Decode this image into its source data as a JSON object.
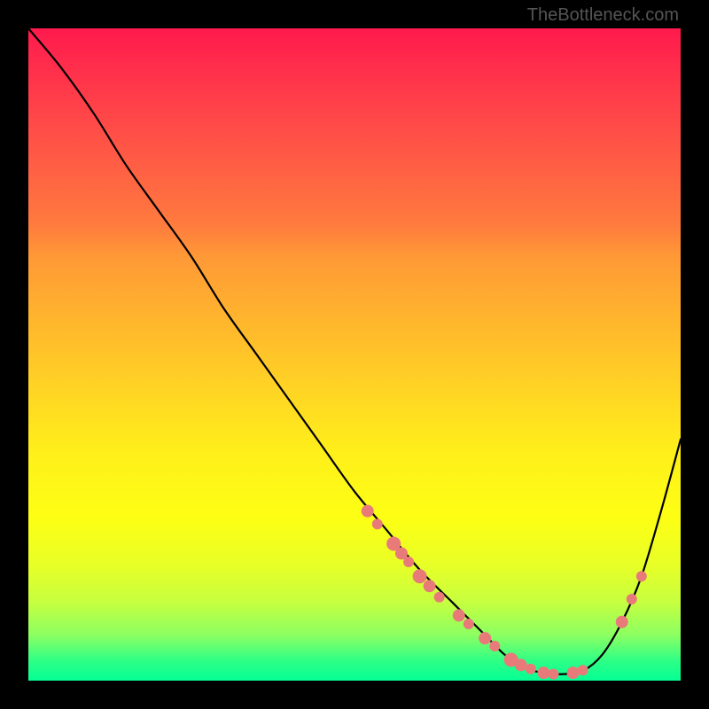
{
  "attribution": "TheBottleneck.com",
  "colors": {
    "curve": "#000000",
    "dot_fill": "#e97a7a",
    "dot_stroke": "#d46262"
  },
  "chart_data": {
    "type": "line",
    "title": "",
    "xlabel": "",
    "ylabel": "",
    "xlim": [
      0,
      100
    ],
    "ylim": [
      0,
      100
    ],
    "grid": false,
    "legend": false,
    "series": [
      {
        "name": "bottleneck_curve",
        "x": [
          0,
          5,
          10,
          15,
          20,
          25,
          30,
          35,
          40,
          45,
          50,
          55,
          60,
          65,
          68,
          70,
          73,
          76,
          79,
          82,
          85,
          88,
          91,
          94,
          97,
          100
        ],
        "y": [
          100,
          94,
          87,
          79,
          72,
          65,
          57,
          50,
          43,
          36,
          29,
          23,
          17,
          12,
          9,
          7,
          4,
          2,
          1.2,
          1,
          1.5,
          4,
          9,
          16,
          26,
          37
        ]
      }
    ],
    "markers": [
      {
        "x": 52,
        "y": 26,
        "r": 7
      },
      {
        "x": 53.5,
        "y": 24,
        "r": 6
      },
      {
        "x": 56,
        "y": 21,
        "r": 8
      },
      {
        "x": 57.2,
        "y": 19.5,
        "r": 7
      },
      {
        "x": 58.3,
        "y": 18.2,
        "r": 6
      },
      {
        "x": 60,
        "y": 16,
        "r": 8
      },
      {
        "x": 61.5,
        "y": 14.5,
        "r": 7
      },
      {
        "x": 63,
        "y": 12.8,
        "r": 6
      },
      {
        "x": 66,
        "y": 10,
        "r": 7
      },
      {
        "x": 67.5,
        "y": 8.7,
        "r": 6
      },
      {
        "x": 70,
        "y": 6.5,
        "r": 7
      },
      {
        "x": 71.5,
        "y": 5.3,
        "r": 6
      },
      {
        "x": 74,
        "y": 3.2,
        "r": 8
      },
      {
        "x": 75.5,
        "y": 2.4,
        "r": 7
      },
      {
        "x": 77,
        "y": 1.8,
        "r": 6
      },
      {
        "x": 79,
        "y": 1.2,
        "r": 7
      },
      {
        "x": 80.5,
        "y": 1.0,
        "r": 6
      },
      {
        "x": 83.5,
        "y": 1.2,
        "r": 7
      },
      {
        "x": 85,
        "y": 1.6,
        "r": 6
      },
      {
        "x": 91,
        "y": 9,
        "r": 7
      },
      {
        "x": 92.5,
        "y": 12.5,
        "r": 6
      },
      {
        "x": 94,
        "y": 16,
        "r": 6
      }
    ]
  }
}
